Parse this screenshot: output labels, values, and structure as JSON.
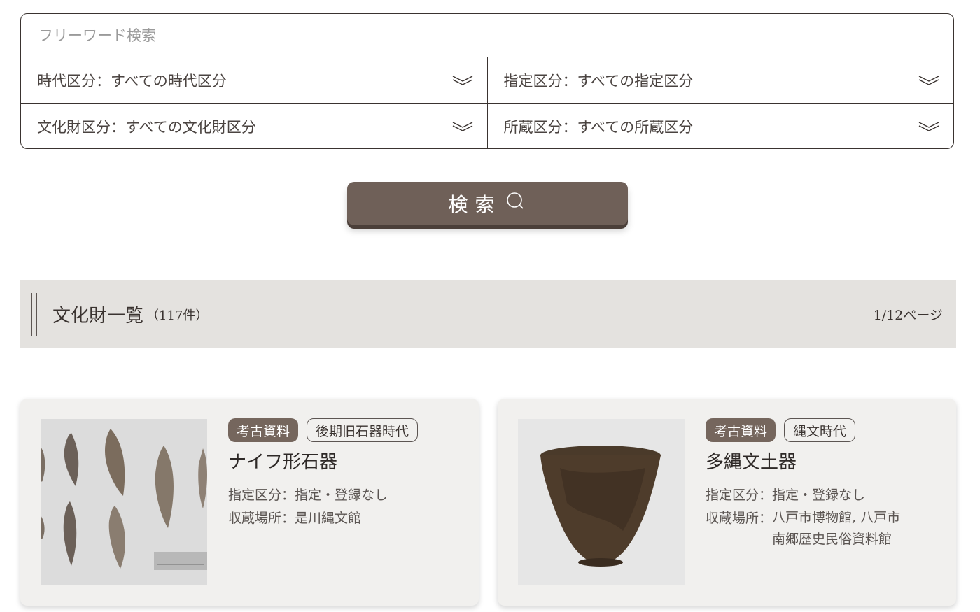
{
  "search": {
    "freeword_placeholder": "フリーワード検索",
    "filters": {
      "period": "時代区分：すべての時代区分",
      "designation": "指定区分：すべての指定区分",
      "category": "文化財区分：すべての文化財区分",
      "holding": "所蔵区分：すべての所蔵区分"
    },
    "button_label": "検索"
  },
  "list": {
    "title": "文化財一覧",
    "count": "（117件）",
    "page_info": "1/12ページ"
  },
  "cards": [
    {
      "tags": [
        "考古資料",
        "後期旧石器時代"
      ],
      "title": "ナイフ形石器",
      "designation_key": "指定区分：",
      "designation_val": "指定・登録なし",
      "location_key": "収蔵場所：",
      "location_lines": [
        "是川縄文館"
      ]
    },
    {
      "tags": [
        "考古資料",
        "縄文時代"
      ],
      "title": "多縄文土器",
      "designation_key": "指定区分：",
      "designation_val": "指定・登録なし",
      "location_key": "収蔵場所：",
      "location_lines": [
        "八戸市博物館, 八戸市",
        "南郷歴史民俗資料館"
      ]
    }
  ],
  "colors": {
    "button_bg": "#6f6058",
    "header_bg": "#e4e2df",
    "card_bg": "#f1f0ee",
    "tag_filled": "#75665d",
    "border": "#3a3330"
  }
}
